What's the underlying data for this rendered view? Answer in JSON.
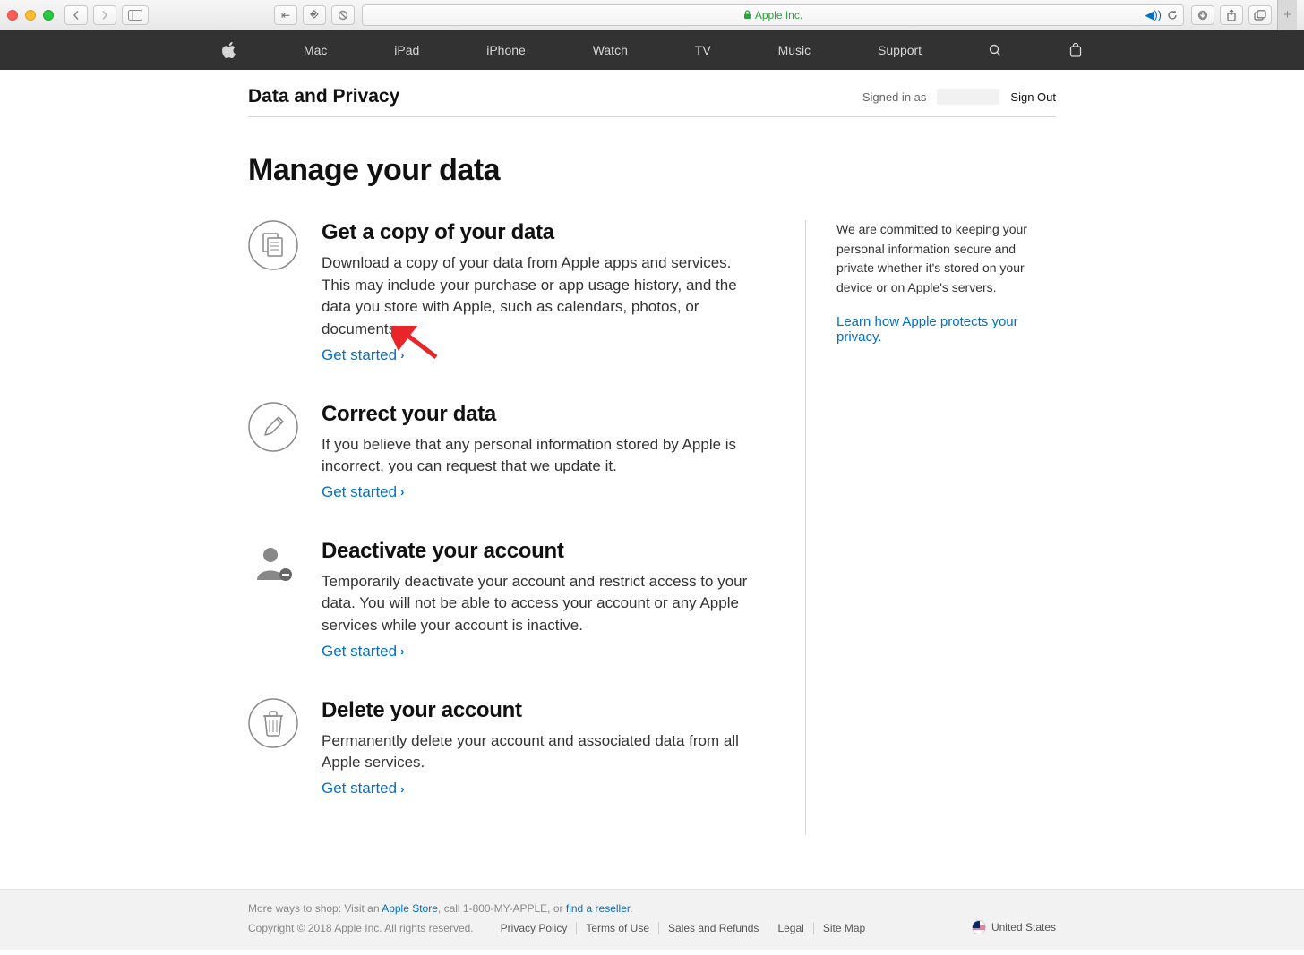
{
  "browser": {
    "site_label": "Apple Inc."
  },
  "nav": {
    "items": [
      "Mac",
      "iPad",
      "iPhone",
      "Watch",
      "TV",
      "Music",
      "Support"
    ]
  },
  "subnav": {
    "title": "Data and Privacy",
    "signed_in_label": "Signed in as",
    "signout": "Sign Out"
  },
  "page": {
    "heading": "Manage your data"
  },
  "options": [
    {
      "title": "Get a copy of your data",
      "desc": "Download a copy of your data from Apple apps and services. This may include your purchase or app usage history, and the data you store with Apple, such as calendars, photos, or documents.",
      "cta": "Get started"
    },
    {
      "title": "Correct your data",
      "desc": "If you believe that any personal information stored by Apple is incorrect, you can request that we update it.",
      "cta": "Get started"
    },
    {
      "title": "Deactivate your account",
      "desc": "Temporarily deactivate your account and restrict access to your data. You will not be able to access your account or any Apple services while your account is inactive.",
      "cta": "Get started"
    },
    {
      "title": "Delete your account",
      "desc": "Permanently delete your account and associated data from all Apple services.",
      "cta": "Get started"
    }
  ],
  "sidebar": {
    "intro": "We are committed to keeping your personal information secure and private whether it's stored on your device or on Apple's servers.",
    "link": "Learn how Apple protects your privacy."
  },
  "footer": {
    "shop_prefix": "More ways to shop: Visit an ",
    "shop_link1": "Apple Store",
    "shop_mid": ", call 1-800-MY-APPLE, or ",
    "shop_link2": "find a reseller",
    "shop_suffix": ".",
    "copyright": "Copyright © 2018 Apple Inc. All rights reserved.",
    "links": [
      "Privacy Policy",
      "Terms of Use",
      "Sales and Refunds",
      "Legal",
      "Site Map"
    ],
    "locale": "United States"
  }
}
